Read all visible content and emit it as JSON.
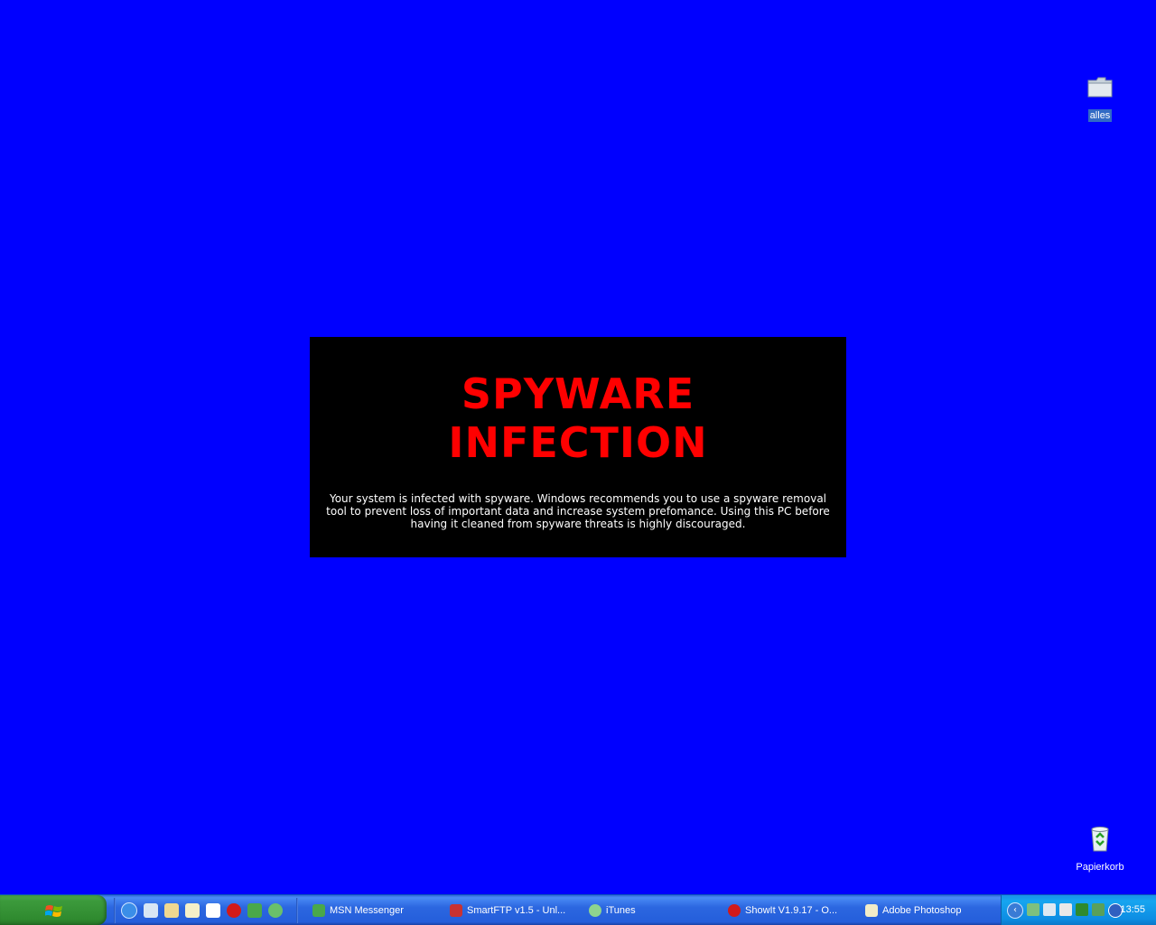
{
  "desktop": {
    "background_color": "#0000ff",
    "icons": [
      {
        "label": "alles",
        "icon": "folder-icon",
        "selected": true
      },
      {
        "label": "Papierkorb",
        "icon": "recycle-bin-icon",
        "selected": false
      }
    ]
  },
  "warning": {
    "title_line1": "SPYWARE",
    "title_line2": "INFECTION",
    "message": "Your system is infected with spyware. Windows recommends you to use a spyware removal tool to prevent loss of important data and increase system prefomance. Using this PC before having it cleaned from spyware threats is highly discouraged.",
    "title_color": "#ff0000",
    "background": "#000000"
  },
  "taskbar": {
    "start_icon": "windows-logo-icon",
    "quick_launch": [
      "internet-explorer-icon",
      "show-desktop-icon",
      "explorer-icon",
      "notepad-icon",
      "gmail-icon",
      "opera-icon",
      "msn-icon",
      "media-icon"
    ],
    "tasks": [
      {
        "label": "MSN Messenger",
        "icon": "msn-icon"
      },
      {
        "label": "SmartFTP v1.5 - Unl...",
        "icon": "smartftp-icon"
      },
      {
        "label": "iTunes",
        "icon": "itunes-icon"
      },
      {
        "label": "ShowIt V1.9.17 - O...",
        "icon": "showit-icon"
      },
      {
        "label": "Adobe Photoshop",
        "icon": "photoshop-icon"
      }
    ],
    "tray_icons": [
      "network-icon",
      "monitor-icon",
      "usb-icon",
      "battery-icon",
      "antivirus-icon",
      "security-icon",
      "update-icon"
    ],
    "clock": "13:55"
  }
}
